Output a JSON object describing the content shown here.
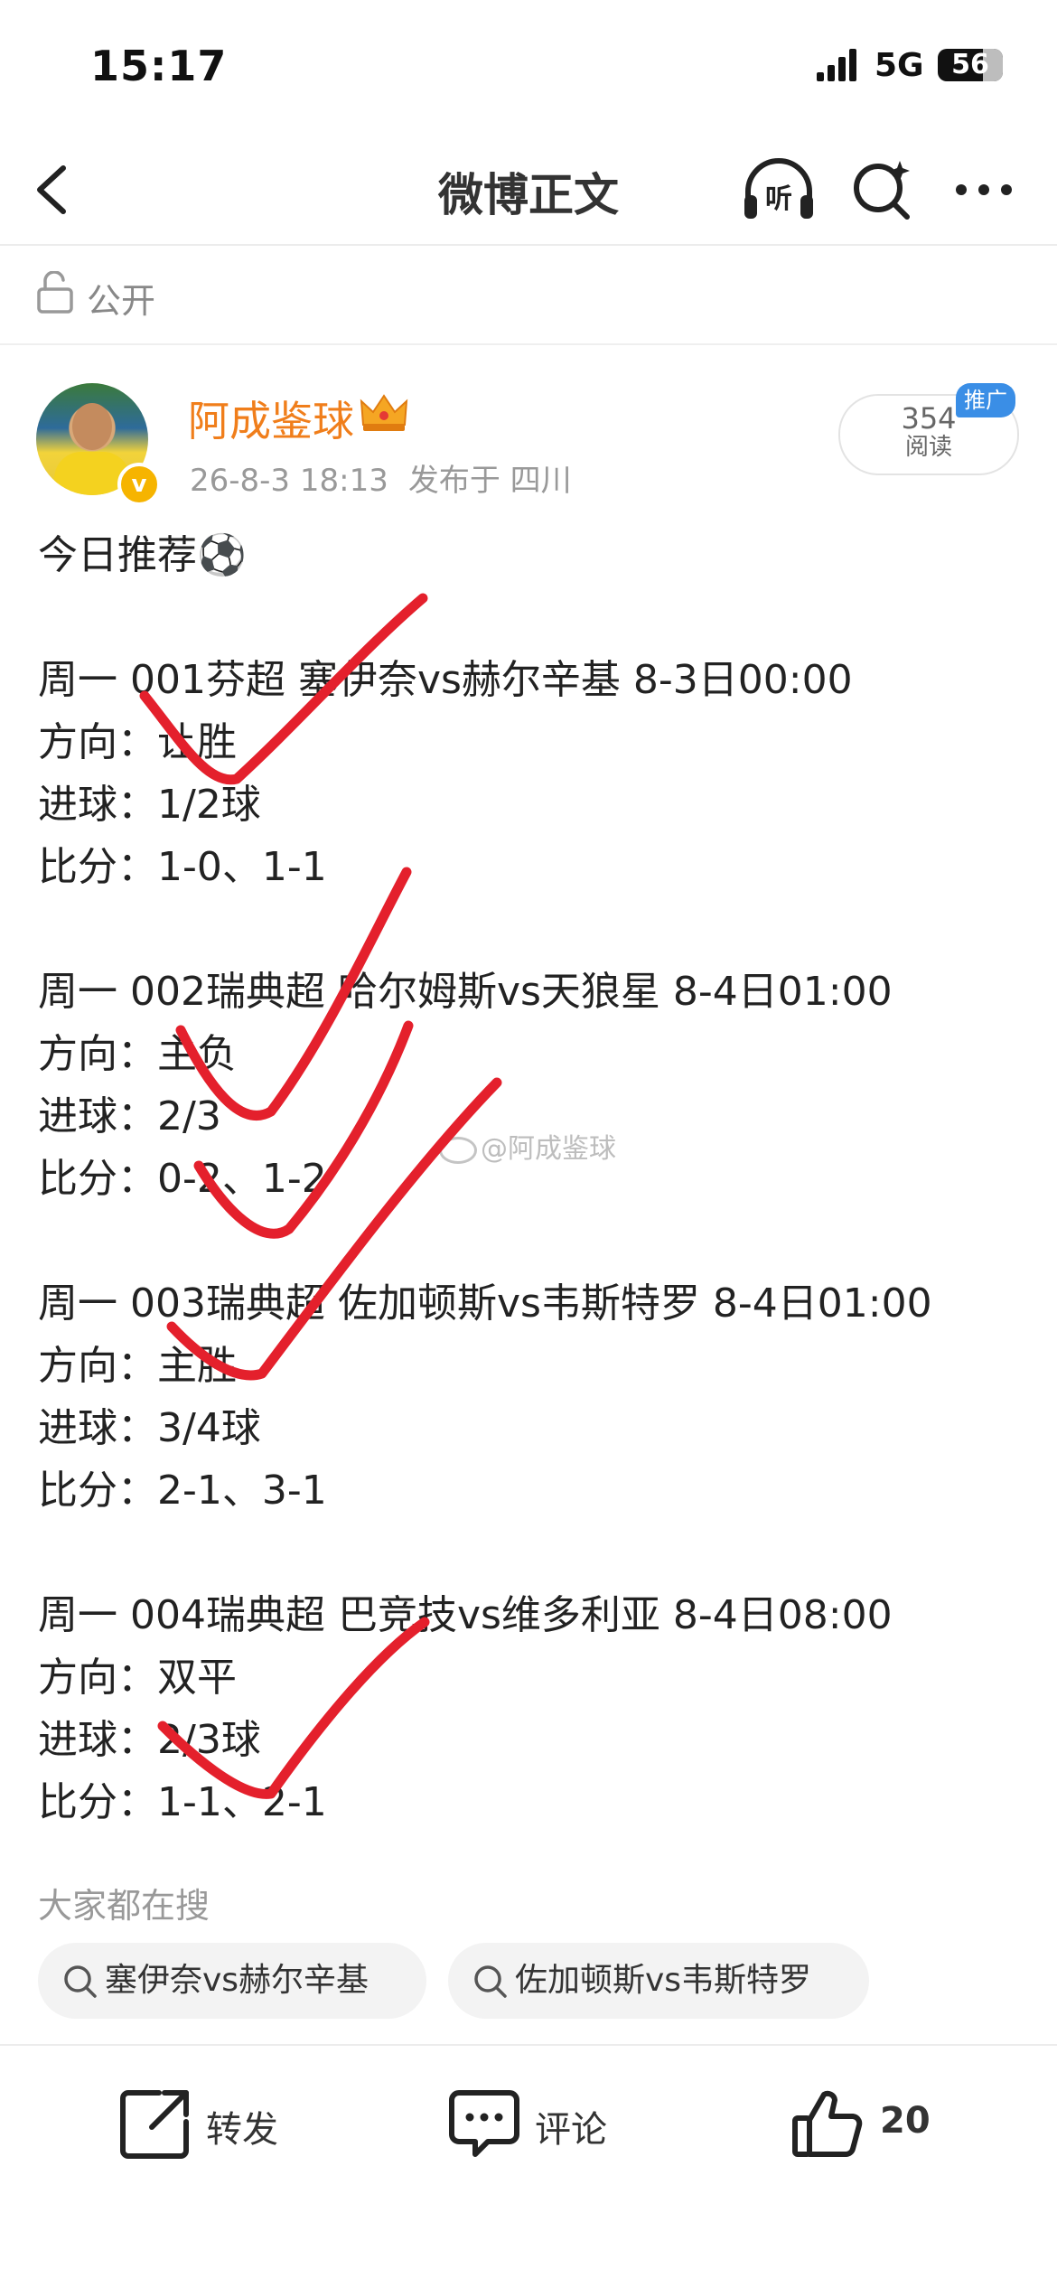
{
  "status_bar": {
    "time": "15:17",
    "network": "5G",
    "battery": "56"
  },
  "nav": {
    "title": "微博正文"
  },
  "visibility": {
    "label": "公开"
  },
  "author": {
    "name": "阿成鉴球",
    "date": "26-8-3 18:13",
    "location": "发布于 四川",
    "reads": "354",
    "reads_label": "阅读",
    "promo": "推广",
    "verified": "v"
  },
  "post": {
    "intro": "今日推荐⚽",
    "matches": [
      {
        "header": "周一 001芬超 塞伊奈vs赫尔辛基  8-3日00:00",
        "direction": "方向：让胜",
        "goals": "进球：1/2球",
        "score": "比分：1-0、1-1"
      },
      {
        "header": "周一 002瑞典超 哈尔姆斯vs天狼星 8-4日01:00",
        "direction": "方向：主负",
        "goals": "进球：2/3",
        "score": "比分：0-2、1-2"
      },
      {
        "header": "周一 003瑞典超 佐加顿斯vs韦斯特罗 8-4日01:00",
        "direction": "方向：主胜",
        "goals": "进球：3/4球",
        "score": "比分：2-1、3-1"
      },
      {
        "header": "周一 004瑞典超 巴竞技vs维多利亚 8-4日08:00",
        "direction": "方向：双平",
        "goals": "进球：2/3球",
        "score": "比分：1-1、2-1"
      }
    ],
    "watermark": "@阿成鉴球"
  },
  "hot_search": {
    "title": "大家都在搜",
    "chips": [
      "塞伊奈vs赫尔辛基",
      "佐加顿斯vs韦斯特罗"
    ]
  },
  "actions": {
    "forward": "转发",
    "comment": "评论",
    "likes": "20"
  },
  "colors": {
    "author": "#f07e1b",
    "checkmark": "#e4202c",
    "promo": "#3a8ee6"
  }
}
